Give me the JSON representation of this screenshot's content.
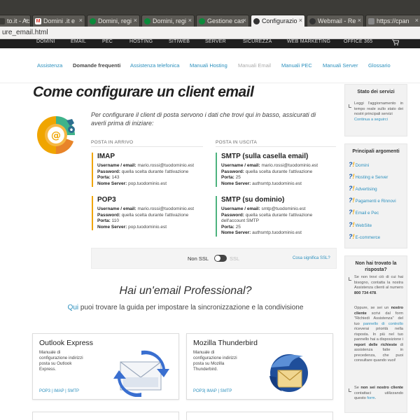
{
  "browser": {
    "tabs": [
      {
        "label": "to.it - Ac",
        "fav": "",
        "fav_color": "#3c3b37"
      },
      {
        "label": "Domini .it e",
        "fav": "M",
        "fav_color": "#d93025"
      },
      {
        "label": "Domini, regi",
        "fav": "",
        "fav_color": "#0a8a3a"
      },
      {
        "label": "Domini, regi",
        "fav": "",
        "fav_color": "#0a8a3a"
      },
      {
        "label": "Gestione cas",
        "fav": "",
        "fav_color": "#0a8a3a"
      },
      {
        "label": "Configurazio",
        "fav": "",
        "fav_color": "#333333"
      },
      {
        "label": "Webmail - Re",
        "fav": "",
        "fav_color": "#333333"
      },
      {
        "label": "https://cpan",
        "fav": "",
        "fav_color": "#888888"
      }
    ],
    "url": "ure_email.html"
  },
  "site_nav": {
    "items": [
      "DOMINI",
      "EMAIL",
      "PEC",
      "HOSTING",
      "SITIWEB",
      "SERVER",
      "SICUREZZA",
      "WEB MARKETING",
      "OFFICE 365"
    ],
    "cart_icon": "cart-icon"
  },
  "sub_nav": {
    "items": [
      "Assistenza",
      "Domande frequenti",
      "Assistenza telefonica",
      "Manuali Hosting",
      "Manuali Email",
      "Manuali PEC",
      "Manuali Server",
      "Glossario"
    ]
  },
  "main": {
    "title": "Come configurare un client email",
    "intro": "Per configurare il client di posta servono i dati che trovi qui in basso, assicurati di averli prima di iniziare:",
    "incoming_head": "POSTA IN ARRIVO",
    "outgoing_head": "POSTA IN USCITA",
    "imap": {
      "title": "IMAP",
      "username_label": "Username / email:",
      "username": "mario.rossi@tuodominio.est",
      "password_label": "Password:",
      "password": "quella scelta durante l'attivazione",
      "port_label": "Porta:",
      "port": "143",
      "server_label": "Nome Server:",
      "server": "pop.tuodominio.est"
    },
    "pop3": {
      "title": "POP3",
      "username_label": "Username / email:",
      "username": "mario.rossi@tuodominio.est",
      "password_label": "Password:",
      "password": "quella scelta durante l'attivazione",
      "port_label": "Porta:",
      "port": "110",
      "server_label": "Nome Server:",
      "server": "pop.tuodominio.est"
    },
    "smtp1": {
      "title": "SMTP (sulla casella email)",
      "username_label": "Username / email:",
      "username": "mario.rossi@tuodominio.est",
      "password_label": "Password:",
      "password": "quella scelta durante l'attivazione",
      "port_label": "Porta:",
      "port": "25",
      "server_label": "Nome Server:",
      "server": "authsmtp.tuodominio.est"
    },
    "smtp2": {
      "title": "SMTP (su dominio)",
      "username_label": "Username / email:",
      "username": "smtp@tuodominio.est",
      "password_label": "Password:",
      "password": "quella scelta durante l'attivazione",
      "password2": "dell'account SMTP",
      "port_label": "Porta:",
      "port": "25",
      "server_label": "Nome Server:",
      "server": "authsmtp.tuodominio.est"
    },
    "ssl": {
      "non_ssl": "Non SSL",
      "ssl": "SSL",
      "link": "Cosa significa SSL?"
    },
    "pro_title": "Hai un'email Professional?",
    "pro_sub_link": "Qui",
    "pro_sub_rest": " puoi trovare la guida per impostare la sincronizzazione e la condivisione",
    "cards": [
      {
        "title": "Outlook Express",
        "desc": "Manuale di configurazione indirizzi posta su Outlook Express.",
        "links": "POP3 | IMAP | SMTP"
      },
      {
        "title": "Mozilla Thunderbird",
        "desc": "Manuale di configurazione indirizzi posta su Mozilla Thunderbird.",
        "links": "POP3| IMAP | SMTP"
      }
    ]
  },
  "sidebar": {
    "services": {
      "title": "Stato dei servizi",
      "text": "Leggi l'aggiornamento in tempo reale sullo stato dei nostri principali servizi",
      "link": "Continua a seguirci"
    },
    "topics": {
      "title": "Principali argomenti",
      "items": [
        "Domini",
        "Hosting e Server",
        "Advertising",
        "Pagamenti e Rinnovi",
        "Email e Pec",
        "WebSite",
        "E-commerce"
      ]
    },
    "help": {
      "title": "Non hai trovato la risposta?",
      "p1": "Se non trovi ciò di cui hai bisogno, contatta la nostra Assistenza clienti al numero ",
      "phone": "800 734 478",
      "p2a": "Oppure, se sei un ",
      "p2b": "nostro cliente",
      "p2c": " scrivi dal form \"Richiedi Assistenza\" del tuo ",
      "p2link": "pannello di controllo",
      "p2d": " riceverai priorità nella risposta. In più nel tuo pannello hai a disposizione i ",
      "p2e": "report delle richieste",
      "p2f": " di assistenza fatte in precedenza, che puoi consultare quando vuoi!",
      "p3a": "Se ",
      "p3b": "non sei nostro cliente",
      "p3c": " contattaci utilizzando questo ",
      "p3link": "form",
      "p3d": "."
    }
  }
}
